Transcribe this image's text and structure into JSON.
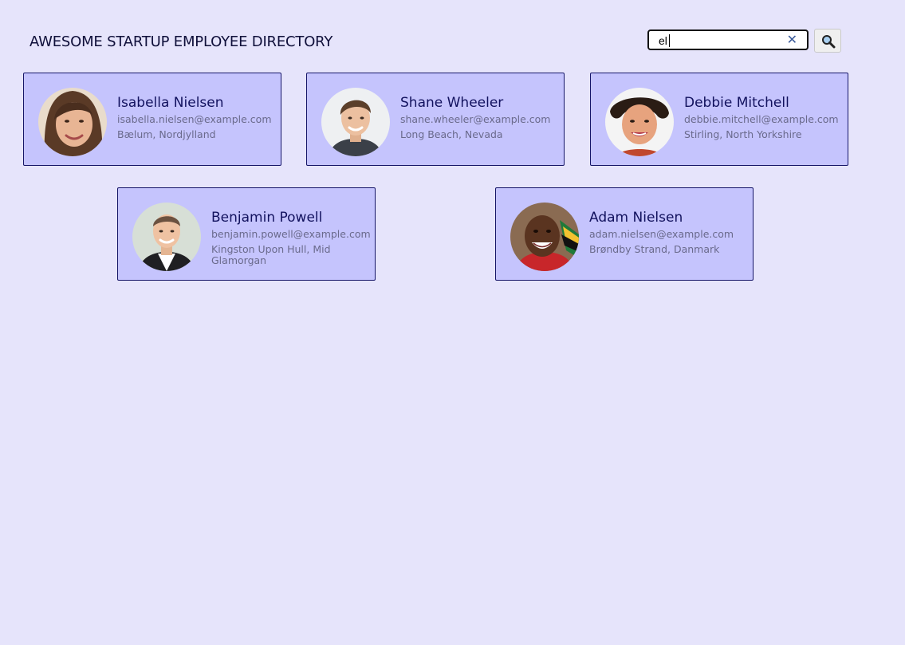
{
  "header": {
    "title": "AWESOME STARTUP EMPLOYEE DIRECTORY"
  },
  "search": {
    "value": "el",
    "clear_icon": "close-icon",
    "button_icon": "magnifier-icon"
  },
  "employees": [
    {
      "name": "Isabella Nielsen",
      "email": "isabella.nielsen@example.com",
      "location": "Bælum, Nordjylland"
    },
    {
      "name": "Shane Wheeler",
      "email": "shane.wheeler@example.com",
      "location": "Long Beach, Nevada"
    },
    {
      "name": "Debbie Mitchell",
      "email": "debbie.mitchell@example.com",
      "location": "Stirling, North Yorkshire"
    },
    {
      "name": "Benjamin Powell",
      "email": "benjamin.powell@example.com",
      "location": "Kingston Upon Hull, Mid Glamorgan"
    },
    {
      "name": "Adam Nielsen",
      "email": "adam.nielsen@example.com",
      "location": "Brøndby Strand, Danmark"
    }
  ],
  "colors": {
    "page_background": "#e6e4fb",
    "card_background": "#c5c4fd",
    "card_border": "#151568",
    "name_text": "#12125e",
    "secondary_text": "#6a6a8c"
  }
}
